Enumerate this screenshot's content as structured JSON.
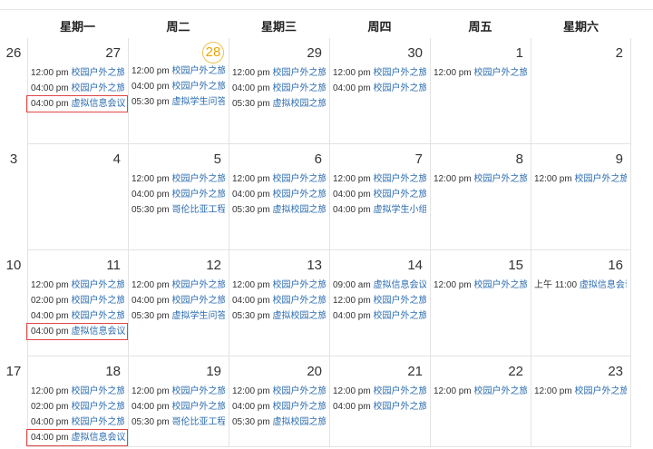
{
  "weekdays": [
    "星期一",
    "周二",
    "星期三",
    "周四",
    "周五",
    "星期六"
  ],
  "weeks": [
    {
      "week_num": "26",
      "days": [
        {
          "num": "27",
          "today": false,
          "events": [
            {
              "time": "12:00 pm",
              "title": "校园户外之旅"
            },
            {
              "time": "04:00 pm",
              "title": "校园户外之旅"
            },
            {
              "time": "04:00 pm",
              "title": "虚拟信息会议",
              "highlight": true
            }
          ]
        },
        {
          "num": "28",
          "today": true,
          "events": [
            {
              "time": "12:00 pm",
              "title": "校园户外之旅"
            },
            {
              "time": "04:00 pm",
              "title": "校园户外之旅"
            },
            {
              "time": "05:30 pm",
              "title": "虚拟学生问答聊"
            }
          ]
        },
        {
          "num": "29",
          "today": false,
          "events": [
            {
              "time": "12:00 pm",
              "title": "校园户外之旅"
            },
            {
              "time": "04:00 pm",
              "title": "校园户外之旅"
            },
            {
              "time": "05:30 pm",
              "title": "虚拟校园之旅"
            }
          ]
        },
        {
          "num": "30",
          "today": false,
          "events": [
            {
              "time": "12:00 pm",
              "title": "校园户外之旅"
            },
            {
              "time": "04:00 pm",
              "title": "校园户外之旅"
            }
          ]
        },
        {
          "num": "1",
          "today": false,
          "events": [
            {
              "time": "12:00 pm",
              "title": "校园户外之旅"
            }
          ]
        },
        {
          "num": "2",
          "today": false,
          "events": []
        }
      ]
    },
    {
      "week_num": "3",
      "days": [
        {
          "num": "4",
          "today": false,
          "events": []
        },
        {
          "num": "5",
          "today": false,
          "events": [
            {
              "time": "12:00 pm",
              "title": "校园户外之旅"
            },
            {
              "time": "04:00 pm",
              "title": "校园户外之旅"
            },
            {
              "time": "05:30 pm",
              "title": "哥伦比亚工程虚"
            }
          ]
        },
        {
          "num": "6",
          "today": false,
          "events": [
            {
              "time": "12:00 pm",
              "title": "校园户外之旅"
            },
            {
              "time": "04:00 pm",
              "title": "校园户外之旅"
            },
            {
              "time": "05:30 pm",
              "title": "虚拟校园之旅"
            }
          ]
        },
        {
          "num": "7",
          "today": false,
          "events": [
            {
              "time": "12:00 pm",
              "title": "校园户外之旅"
            },
            {
              "time": "04:00 pm",
              "title": "校园户外之旅"
            },
            {
              "time": "04:00 pm",
              "title": "虚拟学生小组:"
            }
          ]
        },
        {
          "num": "8",
          "today": false,
          "events": [
            {
              "time": "12:00 pm",
              "title": "校园户外之旅"
            }
          ]
        },
        {
          "num": "9",
          "today": false,
          "events": [
            {
              "time": "12:00 pm",
              "title": "校园户外之旅"
            }
          ]
        }
      ]
    },
    {
      "week_num": "10",
      "days": [
        {
          "num": "11",
          "today": false,
          "events": [
            {
              "time": "12:00 pm",
              "title": "校园户外之旅"
            },
            {
              "time": "02:00 pm",
              "title": "校园户外之旅"
            },
            {
              "time": "04:00 pm",
              "title": "校园户外之旅"
            },
            {
              "time": "04:00 pm",
              "title": "虚拟信息会议",
              "highlight": true
            }
          ]
        },
        {
          "num": "12",
          "today": false,
          "events": [
            {
              "time": "12:00 pm",
              "title": "校园户外之旅"
            },
            {
              "time": "04:00 pm",
              "title": "校园户外之旅"
            },
            {
              "time": "05:30 pm",
              "title": "虚拟学生问答聊"
            }
          ]
        },
        {
          "num": "13",
          "today": false,
          "events": [
            {
              "time": "12:00 pm",
              "title": "校园户外之旅"
            },
            {
              "time": "04:00 pm",
              "title": "校园户外之旅"
            },
            {
              "time": "05:30 pm",
              "title": "虚拟校园之旅"
            }
          ]
        },
        {
          "num": "14",
          "today": false,
          "events": [
            {
              "time": "09:00 am",
              "title": "虚拟信息会议"
            },
            {
              "time": "12:00 pm",
              "title": "校园户外之旅"
            },
            {
              "time": "04:00 pm",
              "title": "校园户外之旅"
            }
          ]
        },
        {
          "num": "15",
          "today": false,
          "events": [
            {
              "time": "12:00 pm",
              "title": "校园户外之旅"
            }
          ]
        },
        {
          "num": "16",
          "today": false,
          "events": [
            {
              "time": "上午 11:00",
              "title": "虚拟信息会议"
            }
          ]
        }
      ]
    },
    {
      "week_num": "17",
      "days": [
        {
          "num": "18",
          "today": false,
          "events": [
            {
              "time": "12:00 pm",
              "title": "校园户外之旅"
            },
            {
              "time": "02:00 pm",
              "title": "校园户外之旅"
            },
            {
              "time": "04:00 pm",
              "title": "校园户外之旅"
            },
            {
              "time": "04:00 pm",
              "title": "虚拟信息会议",
              "highlight": true
            }
          ]
        },
        {
          "num": "19",
          "today": false,
          "events": [
            {
              "time": "12:00 pm",
              "title": "校园户外之旅"
            },
            {
              "time": "04:00 pm",
              "title": "校园户外之旅"
            },
            {
              "time": "05:30 pm",
              "title": "哥伦比亚工程虚"
            }
          ]
        },
        {
          "num": "20",
          "today": false,
          "events": [
            {
              "time": "12:00 pm",
              "title": "校园户外之旅"
            },
            {
              "time": "04:00 pm",
              "title": "校园户外之旅"
            },
            {
              "time": "05:30 pm",
              "title": "虚拟校园之旅"
            }
          ]
        },
        {
          "num": "21",
          "today": false,
          "events": [
            {
              "time": "12:00 pm",
              "title": "校园户外之旅"
            },
            {
              "time": "04:00 pm",
              "title": "校园户外之旅"
            }
          ]
        },
        {
          "num": "22",
          "today": false,
          "events": [
            {
              "time": "12:00 pm",
              "title": "校园户外之旅"
            }
          ]
        },
        {
          "num": "23",
          "today": false,
          "events": [
            {
              "time": "12:00 pm",
              "title": "校园户外之旅"
            }
          ]
        }
      ]
    }
  ]
}
